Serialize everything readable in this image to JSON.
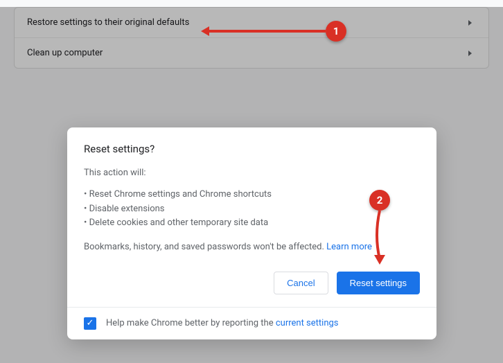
{
  "settings_rows": {
    "restore": "Restore settings to their original defaults",
    "cleanup": "Clean up computer"
  },
  "dialog": {
    "title": "Reset settings?",
    "intro": "This action will:",
    "bullets": {
      "b1": "• Reset Chrome settings and Chrome shortcuts",
      "b2": "• Disable extensions",
      "b3": "• Delete cookies and other temporary site data"
    },
    "note_prefix": "Bookmarks, history, and saved passwords won't be affected. ",
    "learn_more": "Learn more",
    "cancel": "Cancel",
    "reset": "Reset settings",
    "footer_prefix": "Help make Chrome better by reporting the ",
    "footer_link": "current settings"
  },
  "annotations": {
    "badge1": "1",
    "badge2": "2"
  }
}
